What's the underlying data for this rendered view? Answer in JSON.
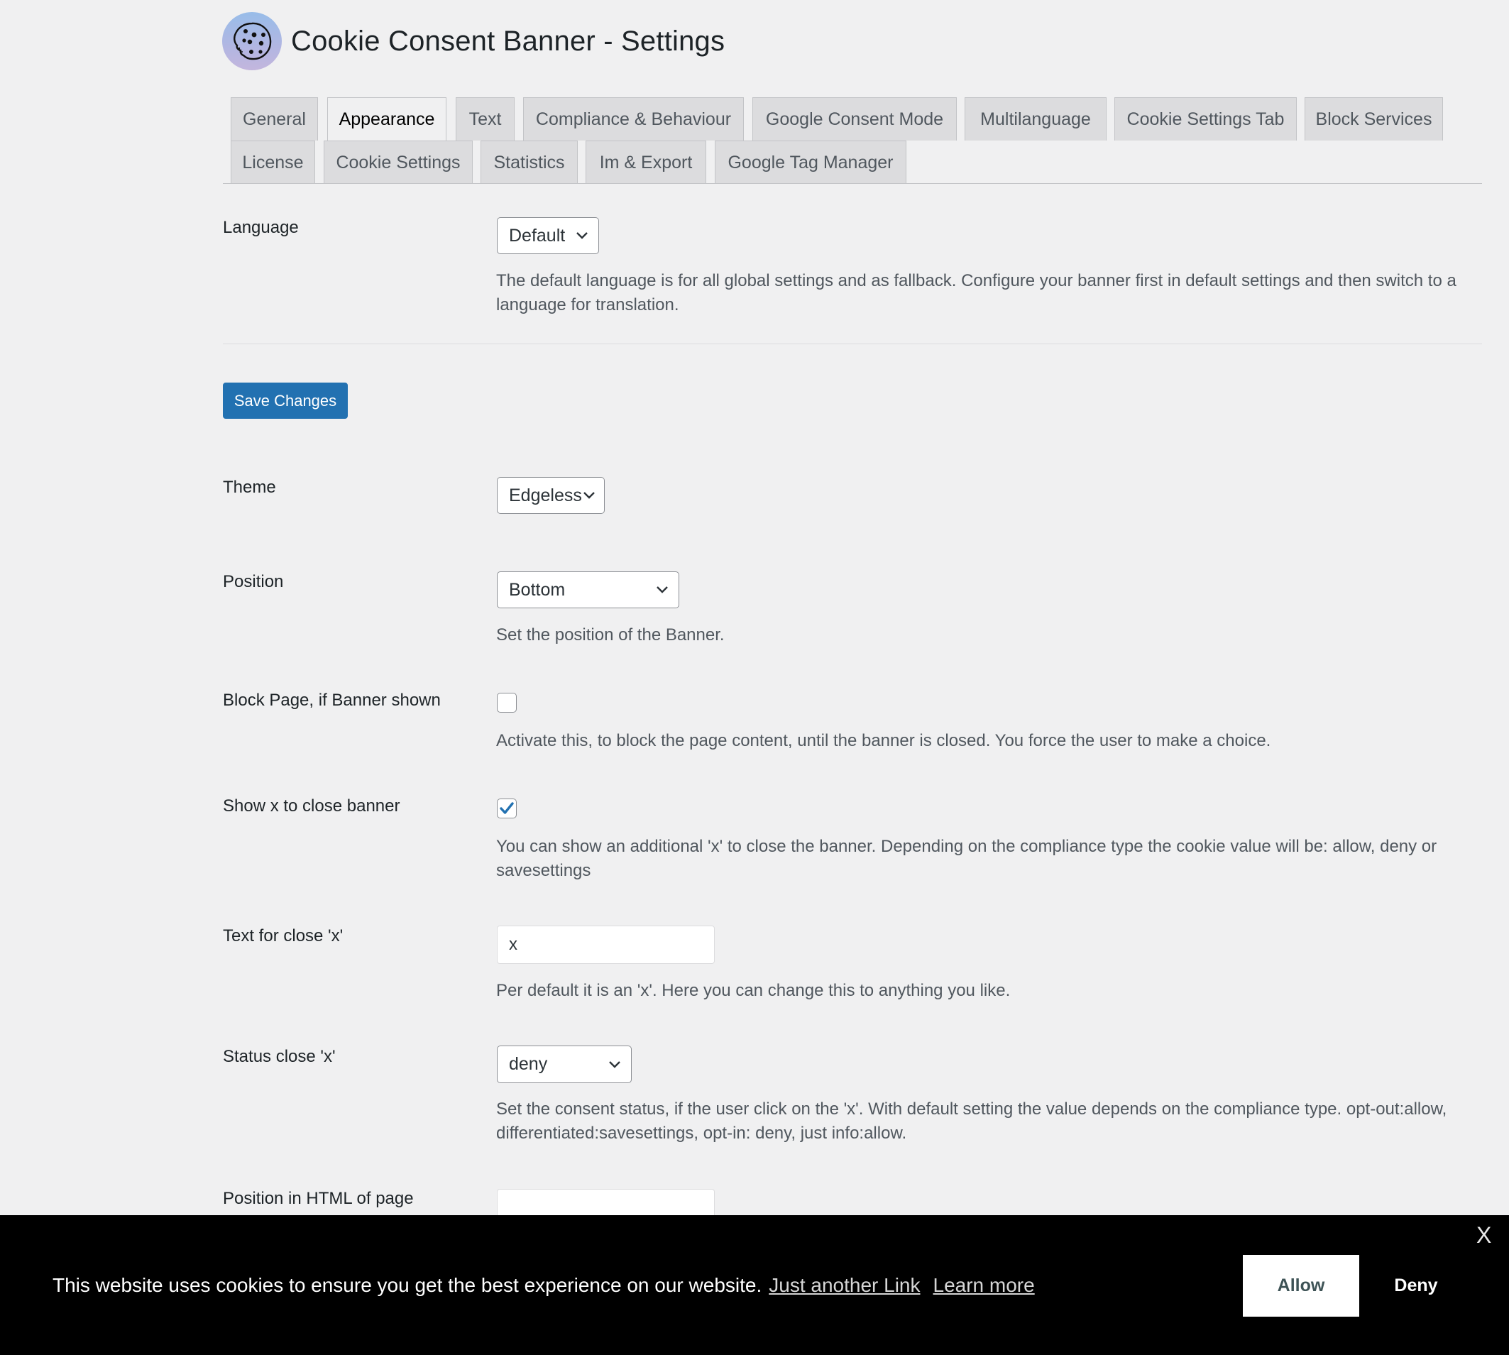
{
  "header": {
    "title": "Cookie Consent Banner - Settings",
    "logo_icon": "cookie-icon"
  },
  "tabs": {
    "row1": [
      {
        "label": "General",
        "active": false
      },
      {
        "label": "Appearance",
        "active": true
      },
      {
        "label": "Text",
        "active": false
      },
      {
        "label": "Compliance & Behaviour",
        "active": false
      },
      {
        "label": "Google Consent Mode",
        "active": false
      },
      {
        "label": "Multilanguage",
        "active": false
      },
      {
        "label": "Cookie Settings Tab",
        "active": false
      },
      {
        "label": "Block Services",
        "active": false
      }
    ],
    "row2": [
      {
        "label": "License",
        "active": false
      },
      {
        "label": "Cookie Settings",
        "active": false
      },
      {
        "label": "Statistics",
        "active": false
      },
      {
        "label": "Im & Export",
        "active": false
      },
      {
        "label": "Google Tag Manager",
        "active": false
      }
    ]
  },
  "language": {
    "label": "Language",
    "value": "Default",
    "description": "The default language is for all global settings and as fallback. Configure your banner first in default settings and then switch to a language for translation."
  },
  "save_button": "Save Changes",
  "fields": {
    "theme": {
      "label": "Theme",
      "value": "Edgeless"
    },
    "position": {
      "label": "Position",
      "value": "Bottom",
      "description": "Set the position of the Banner."
    },
    "block_page": {
      "label": "Block Page, if Banner shown",
      "checked": false,
      "description": "Activate this, to block the page content, until the banner is closed. You force the user to make a choice."
    },
    "show_x": {
      "label": "Show x to close banner",
      "checked": true,
      "description": "You can show an additional 'x' to close the banner. Depending on the compliance type the cookie value will be: allow, deny or savesettings"
    },
    "text_close": {
      "label": "Text for close 'x'",
      "value": "x",
      "description": "Per default it is an 'x'. Here you can change this to anything you like."
    },
    "status_close": {
      "label": "Status close 'x'",
      "value": "deny",
      "description": "Set the consent status, if the user click on the 'x'. With default setting the value depends on the compliance type. opt-out:allow, differentiated:savesettings, opt-in: deny, just info:allow."
    },
    "position_html": {
      "label": "Position in HTML of page",
      "value": ""
    }
  },
  "banner": {
    "message": "This website uses cookies to ensure you get the best experience on our website.",
    "link1": "Just another Link",
    "link2": "Learn more",
    "allow": "Allow",
    "deny": "Deny",
    "close": "X",
    "colors": {
      "background": "#000000",
      "text": "#ffffff",
      "allow_bg": "#ffffff",
      "allow_text": "#3e5356"
    }
  },
  "colors": {
    "accent": "#2271b1",
    "page_bg": "#f0f0f1",
    "tab_bg": "#dcdcde"
  }
}
